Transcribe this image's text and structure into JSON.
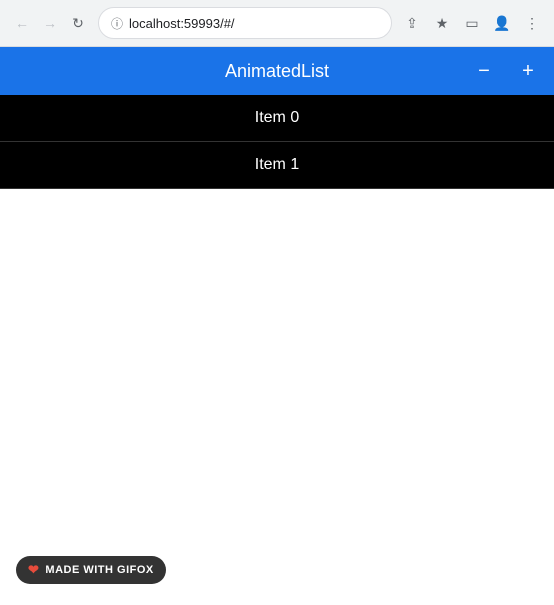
{
  "browser": {
    "url": "localhost:59993/#/",
    "back_disabled": true,
    "forward_disabled": true
  },
  "app": {
    "title": "AnimatedList",
    "minus_label": "−",
    "plus_label": "+"
  },
  "list": {
    "items": [
      {
        "label": "Item 0"
      },
      {
        "label": "Item 1"
      }
    ]
  },
  "badge": {
    "text": "MADE WITH GIFOX"
  }
}
